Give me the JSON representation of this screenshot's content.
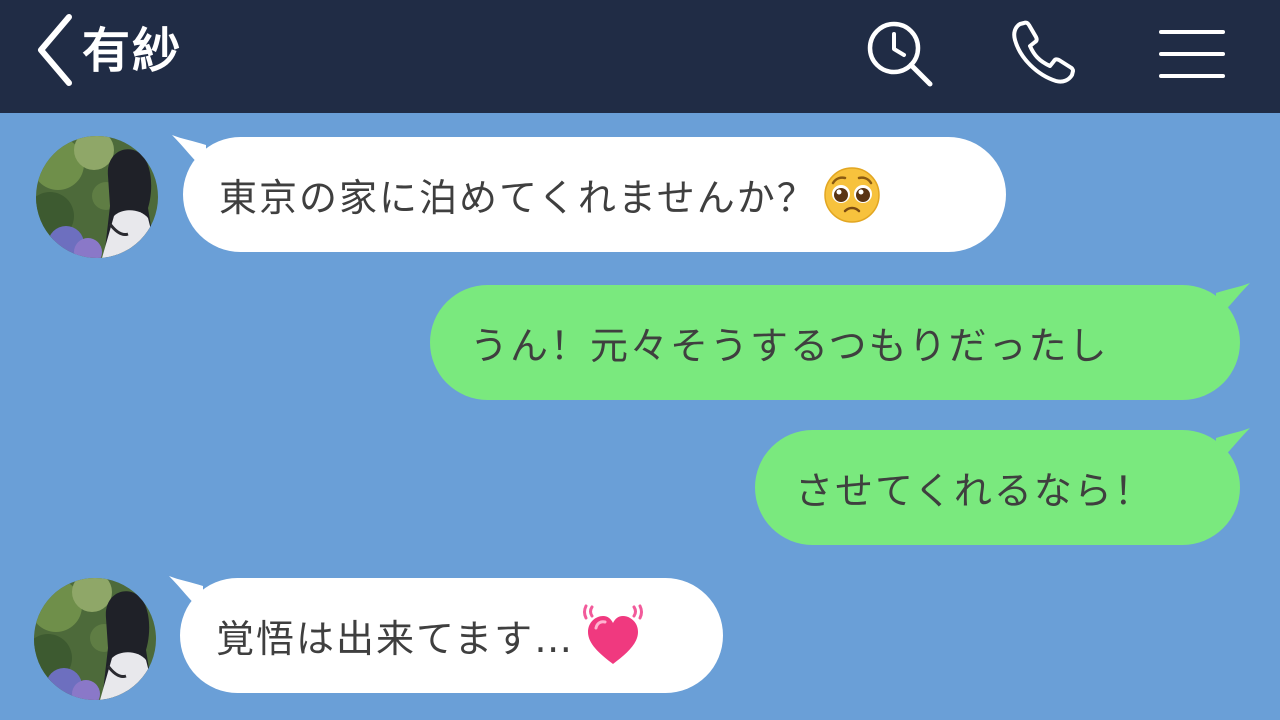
{
  "header": {
    "title": "有紗",
    "background": "#202c45",
    "icons": [
      "back-chevron-icon",
      "search-clock-icon",
      "phone-icon",
      "menu-icon"
    ]
  },
  "chat": {
    "background": "#6a9fd7",
    "incoming_bubble_color": "#ffffff",
    "outgoing_bubble_color": "#7ae97e",
    "messages": [
      {
        "direction": "incoming",
        "text": "東京の家に泊めてくれませんか？",
        "emoji": "pleading-face-emoji"
      },
      {
        "direction": "outgoing",
        "text": "うん！元々そうするつもりだったし"
      },
      {
        "direction": "outgoing",
        "text": "させてくれるなら！"
      },
      {
        "direction": "incoming",
        "text": "覚悟は出来てます…",
        "emoji": "beating-heart-emoji"
      }
    ]
  }
}
